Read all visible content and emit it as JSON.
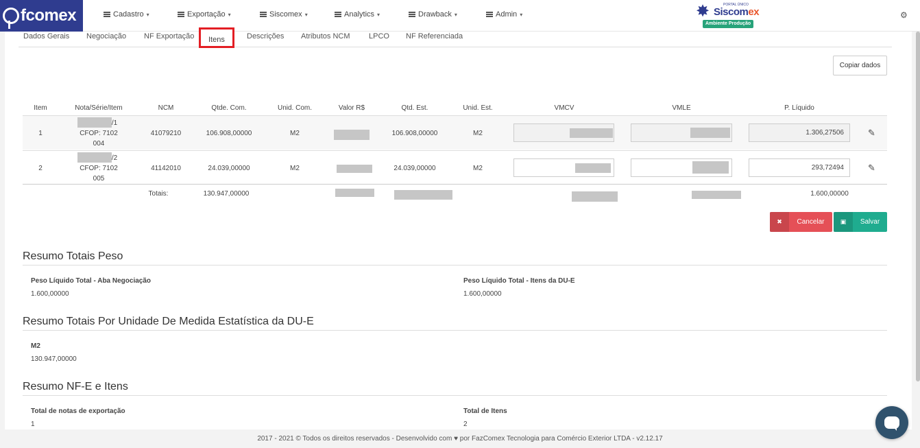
{
  "nav": {
    "logo_text": "fcomex",
    "menu": [
      {
        "label": "Cadastro"
      },
      {
        "label": "Exportação"
      },
      {
        "label": "Siscomex"
      },
      {
        "label": "Analytics"
      },
      {
        "label": "Drawback"
      },
      {
        "label": "Admin"
      }
    ],
    "siscomex": {
      "portal": "PORTAL ÚNICO",
      "name_a": "Siscom",
      "name_b": "ex",
      "env": "Ambiente Produção"
    }
  },
  "tabs": [
    "Dados Gerais",
    "Negociação",
    "NF Exportação",
    "Itens",
    "Descrições",
    "Atributos NCM",
    "LPCO",
    "NF Referenciada"
  ],
  "copy_button": "Copiar dados",
  "table": {
    "headers": [
      "Item",
      "Nota/Série/Item",
      "NCM",
      "Qtde. Com.",
      "Unid. Com.",
      "Valor R$",
      "Qtd. Est.",
      "Unid. Est.",
      "VMCV",
      "VMLE",
      "P. Líquido"
    ],
    "rows": [
      {
        "item": "1",
        "nota_suffix": "/1",
        "cfop": "CFOP: 7102",
        "cfop2": "004",
        "ncm": "41079210",
        "qtde_com": "106.908,00000",
        "unid_com": "M2",
        "qtd_est": "106.908,00000",
        "unid_est": "M2",
        "p_liquido": "1.306,27506"
      },
      {
        "item": "2",
        "nota_suffix": "/2",
        "cfop": "CFOP: 7102",
        "cfop2": "005",
        "ncm": "41142010",
        "qtde_com": "24.039,00000",
        "unid_com": "M2",
        "qtd_est": "24.039,00000",
        "unid_est": "M2",
        "p_liquido": "293,72494"
      }
    ],
    "totals": {
      "label": "Totais:",
      "qtde_com": "130.947,00000",
      "p_liquido": "1.600,00000"
    }
  },
  "buttons": {
    "cancel": "Cancelar",
    "save": "Salvar"
  },
  "resumo_peso": {
    "title": "Resumo Totais Peso",
    "left_label": "Peso Líquido Total - Aba Negociação",
    "left_value": "1.600,00000",
    "right_label": "Peso Líquido Total - Itens da DU-E",
    "right_value": "1.600,00000"
  },
  "resumo_unidade": {
    "title": "Resumo Totais Por Unidade De Medida Estatística da DU-E",
    "label": "M2",
    "value": "130.947,00000"
  },
  "resumo_nfe": {
    "title": "Resumo NF-E e Itens",
    "left_label": "Total de notas de exportação",
    "left_value": "1",
    "right_label": "Total de Itens",
    "right_value": "2"
  },
  "footer": "2017 - 2021 © Todos os direitos reservados - Desenvolvido com ♥ por FazComex Tecnologia para Comércio Exterior LTDA - v2.12.17",
  "colors": {
    "brand": "#2f3c8f",
    "highlight": "#e31e24",
    "cancel": "#e55057",
    "save": "#1fac8f"
  }
}
